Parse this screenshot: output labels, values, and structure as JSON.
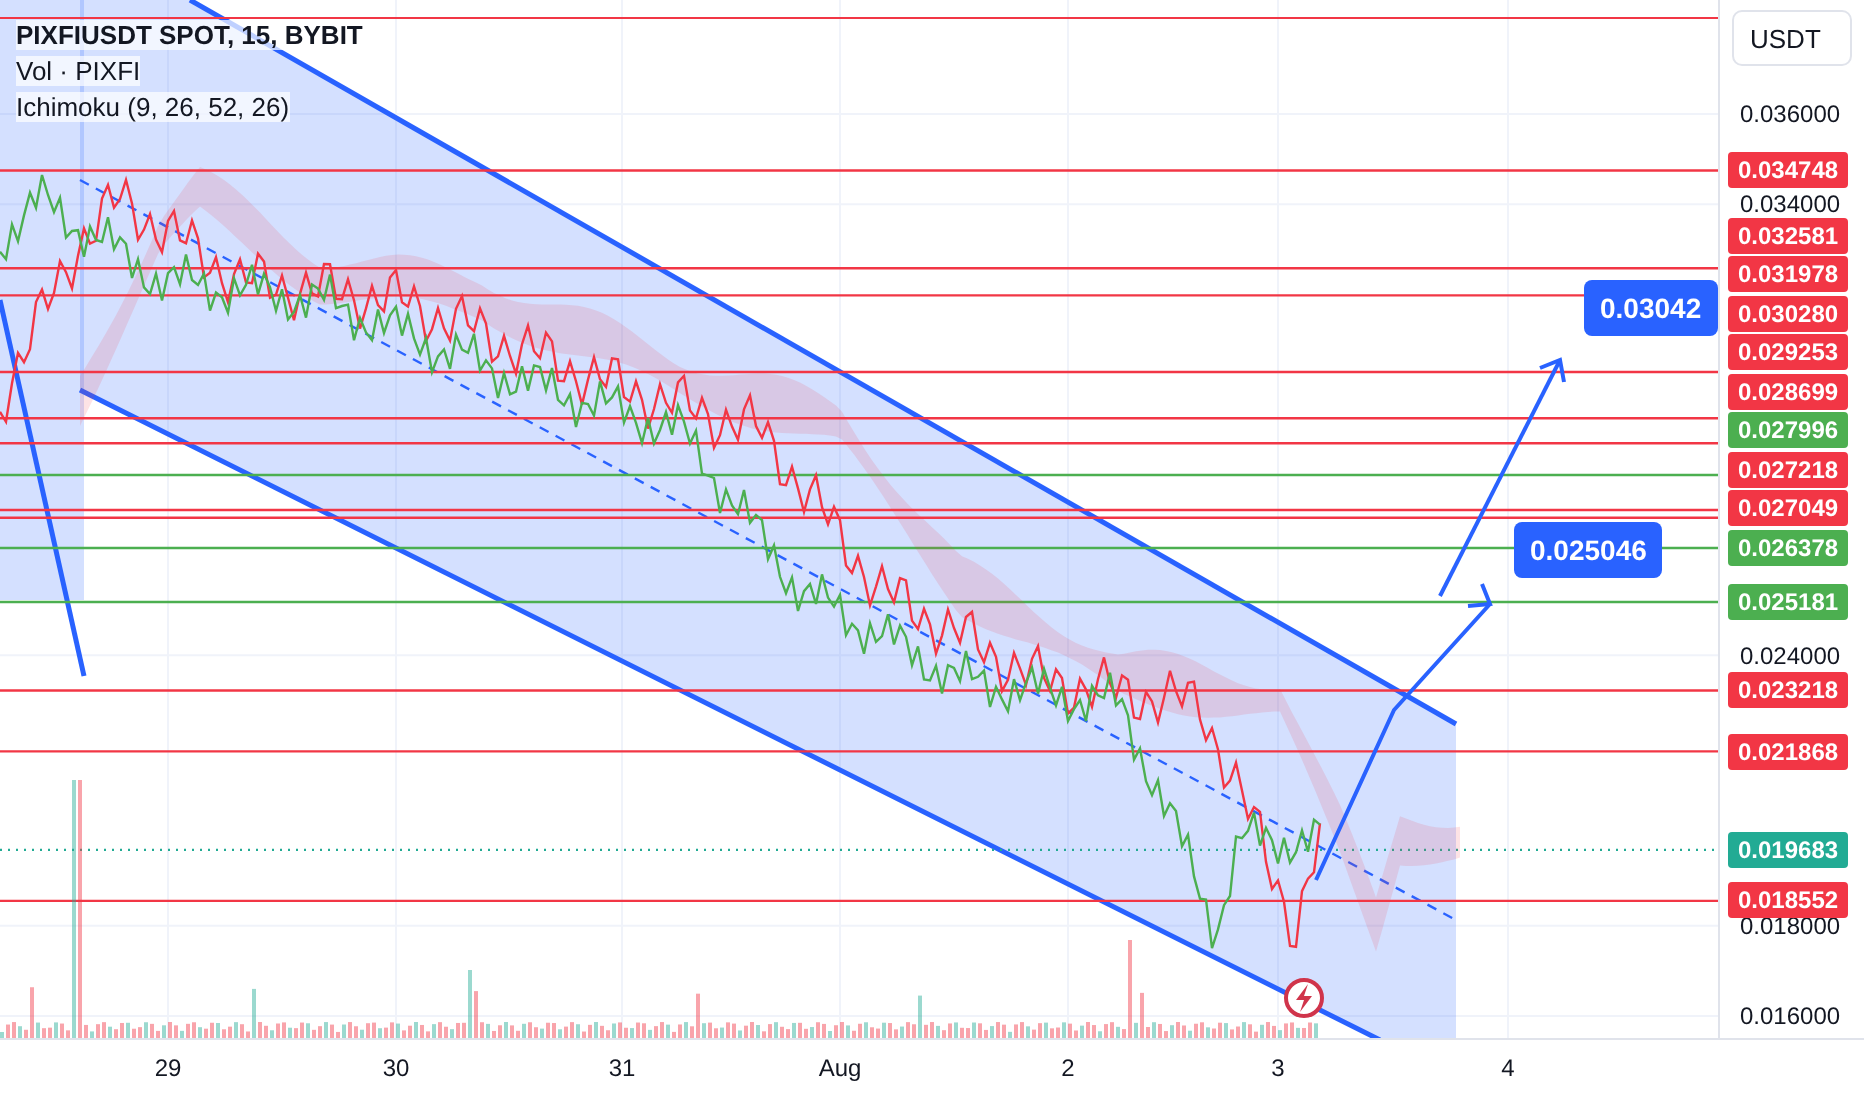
{
  "legend": {
    "title": "PIXFIUSDT SPOT, 15, BYBIT",
    "volume": "Vol · PIXFI",
    "indicator": "Ichimoku (9, 26, 52, 26)"
  },
  "currency_button": "USDT",
  "price_ticks": [
    "0.036000",
    "0.034000",
    "0.024000",
    "0.018000",
    "0.016000"
  ],
  "levels": [
    {
      "price": "0.034748",
      "kind": "solid",
      "color": "#f23645"
    },
    {
      "price": "0.032581",
      "kind": "solid",
      "color": "#f23645"
    },
    {
      "price": "0.031978",
      "kind": "solid",
      "color": "#f23645"
    },
    {
      "price": "0.030280",
      "kind": "solid",
      "color": "#f23645"
    },
    {
      "price": "0.029253",
      "kind": "solid",
      "color": "#f23645"
    },
    {
      "price": "0.028699",
      "kind": "solid",
      "color": "#f23645"
    },
    {
      "price": "0.027996",
      "kind": "solid",
      "color": "#4caf50"
    },
    {
      "price": "0.027218",
      "kind": "solid",
      "color": "#f23645"
    },
    {
      "price": "0.027049",
      "kind": "solid",
      "color": "#f23645"
    },
    {
      "price": "0.026378",
      "kind": "solid",
      "color": "#4caf50"
    },
    {
      "price": "0.025181",
      "kind": "solid",
      "color": "#4caf50"
    },
    {
      "price": "0.023218",
      "kind": "solid",
      "color": "#f23645"
    },
    {
      "price": "0.021868",
      "kind": "solid",
      "color": "#f23645"
    },
    {
      "price": "0.019683",
      "kind": "dotted",
      "color": "#22ab94"
    },
    {
      "price": "0.018552",
      "kind": "solid",
      "color": "#f23645"
    }
  ],
  "targets": [
    {
      "label": "0.03042"
    },
    {
      "label": "0.025046"
    }
  ],
  "time_axis": [
    "29",
    "30",
    "31",
    "Aug",
    "2",
    "3",
    "4"
  ]
}
